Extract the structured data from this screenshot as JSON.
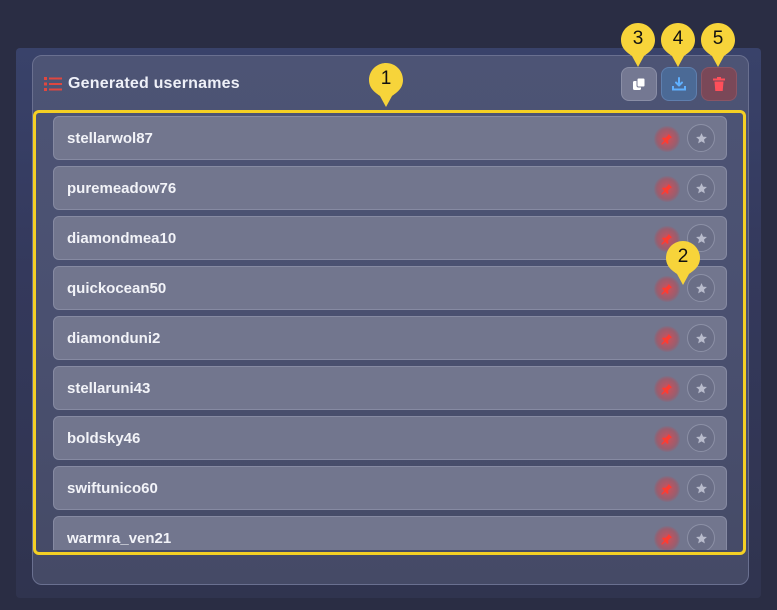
{
  "panel": {
    "title": "Generated usernames",
    "title_icon": "list-icon"
  },
  "toolbar": {
    "copy_icon": "copy-icon",
    "download_icon": "download-icon",
    "delete_icon": "trash-icon"
  },
  "usernames": [
    {
      "label": "stellarwol87"
    },
    {
      "label": "puremeadow76"
    },
    {
      "label": "diamondmea10"
    },
    {
      "label": "quickocean50"
    },
    {
      "label": "diamonduni2"
    },
    {
      "label": "stellaruni43"
    },
    {
      "label": "boldsky46"
    },
    {
      "label": "swiftunico60"
    },
    {
      "label": "warmra_ven21"
    }
  ],
  "row_actions": {
    "pin_icon": "pin-icon",
    "star_icon": "star-icon"
  },
  "callouts": [
    "1",
    "2",
    "3",
    "4",
    "5"
  ],
  "colors": {
    "highlight": "#f5d024",
    "accent_red": "#e04a4a",
    "download_blue": "#4b6a96"
  }
}
